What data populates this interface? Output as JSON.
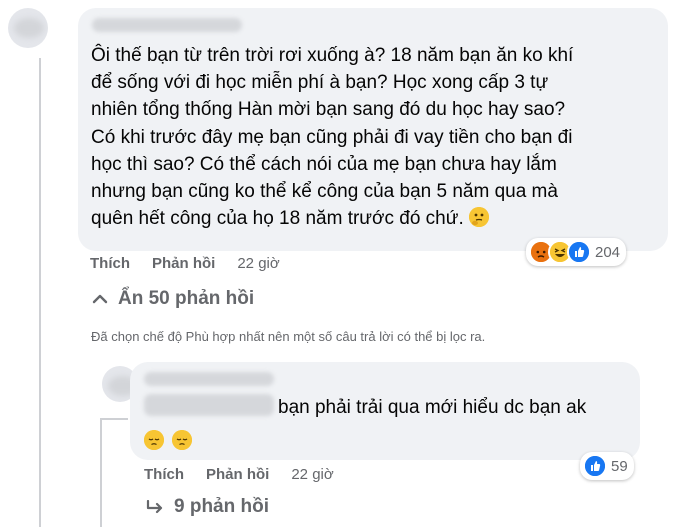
{
  "comment": {
    "text": "Ôi thế bạn từ trên trời rơi xuống à? 18 năm bạn ăn ko khí\nđể sống với đi học miễn phí à bạn? Học xong cấp 3 tự\nnhiên tổng thống Hàn mời bạn sang đó du học hay sao?\nCó khi trước đây mẹ bạn cũng phải đi vay tiền cho bạn đi\nhọc thì sao? Có thể cách nói của mẹ bạn chưa hay lắm\nnhưng bạn cũng ko thể kể công của bạn 5 năm qua mà\nquên hết công của họ 18 năm trước đó chứ.",
    "emoji": "thinking-face-emoji",
    "reactions": [
      "angry",
      "haha",
      "like"
    ],
    "reaction_count": "204",
    "actions": {
      "like": "Thích",
      "reply": "Phản hồi",
      "time": "22 giờ"
    },
    "hide_replies": "Ẩn 50 phản hồi"
  },
  "filter_notice": "Đã chọn chế độ Phù hợp nhất nên một số câu trả lời có thể bị lọc ra.",
  "reply": {
    "text": "bạn phải trải qua mới hiểu dc bạn ak",
    "emojis": [
      "pensive-face",
      "pensive-face"
    ],
    "reactions": [
      "like"
    ],
    "reaction_count": "59",
    "actions": {
      "like": "Thích",
      "reply": "Phản hồi",
      "time": "22 giờ"
    },
    "view_replies": "9 phản hồi"
  },
  "colors": {
    "bubble": "#f0f2f5",
    "secondary_text": "#65676b",
    "like_blue": "#1877f2",
    "angry_orange": "#e9710f",
    "haha_yellow": "#f7c533"
  }
}
